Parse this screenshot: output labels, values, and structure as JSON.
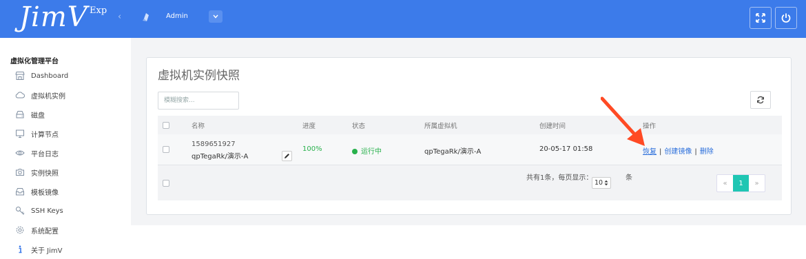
{
  "header": {
    "logo": "JimV",
    "logo_suffix": "Exp",
    "collapse": "‹",
    "user": "Admin"
  },
  "sidebar": {
    "title": "虚拟化管理平台",
    "items": [
      {
        "label": "Dashboard",
        "icon": "store-icon"
      },
      {
        "label": "虚拟机实例",
        "icon": "cloud-icon"
      },
      {
        "label": "磁盘",
        "icon": "disk-icon"
      },
      {
        "label": "计算节点",
        "icon": "monitor-icon"
      },
      {
        "label": "平台日志",
        "icon": "eye-icon"
      },
      {
        "label": "实例快照",
        "icon": "camera-icon"
      },
      {
        "label": "模板镜像",
        "icon": "inbox-icon"
      },
      {
        "label": "SSH Keys",
        "icon": "key-icon"
      },
      {
        "label": "系统配置",
        "icon": "gear-icon"
      },
      {
        "label": "关于 JimV",
        "icon": "info-icon"
      }
    ]
  },
  "panel": {
    "title": "虚拟机实例快照",
    "search_placeholder": "模糊搜索..."
  },
  "table": {
    "headers": [
      "名称",
      "进度",
      "状态",
      "所属虚拟机",
      "创建时间",
      "操作"
    ],
    "rows": [
      {
        "id": "1589651927",
        "name": "qpTegaRk/演示-A",
        "progress": "100%",
        "status": "运行中",
        "vm": "qpTegaRk/演示-A",
        "created": "20-05-17 01:58",
        "ops": [
          "恢复",
          "创建镜像",
          "删除"
        ]
      }
    ]
  },
  "pagination": {
    "info": "共有1条，每页显示：",
    "per_page": "10",
    "unit": "条",
    "prev": "«",
    "current": "1",
    "next": "»"
  },
  "colors": {
    "header": "#3c7bea",
    "active_page": "#1fc6b3",
    "status_green": "#28b14c",
    "link": "#2a6edb",
    "arrow": "#ff4a24"
  }
}
